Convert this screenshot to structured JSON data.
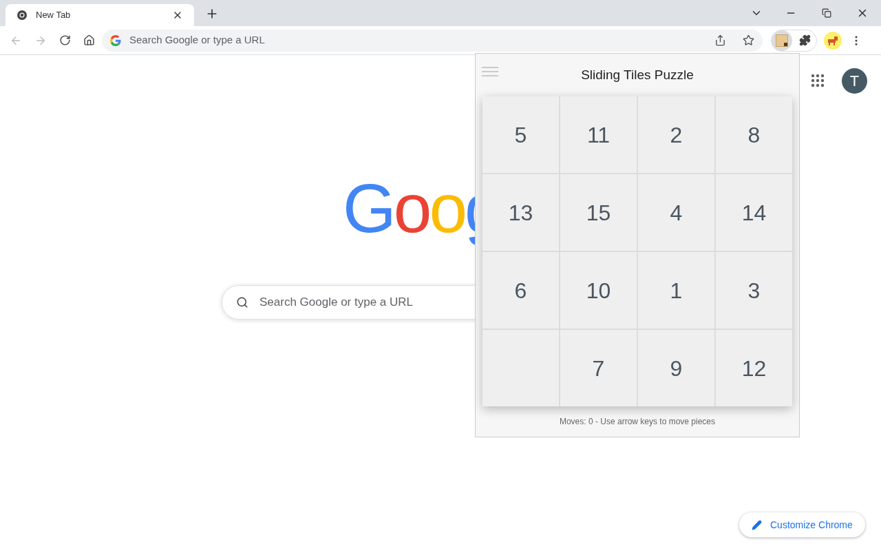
{
  "tab": {
    "title": "New Tab",
    "selected": true
  },
  "omnibox": {
    "placeholder": "Search Google or type a URL"
  },
  "logo": {
    "text": "Goog"
  },
  "search": {
    "placeholder": "Search Google or type a URL"
  },
  "avatar": {
    "initial": "T"
  },
  "popup": {
    "title": "Sliding Tiles Puzzle",
    "status": "Moves: 0 - Use arrow keys to move pieces",
    "tiles": [
      {
        "kind": "tile",
        "label": "5"
      },
      {
        "kind": "tile",
        "label": "11"
      },
      {
        "kind": "tile",
        "label": "2"
      },
      {
        "kind": "tile",
        "label": "8"
      },
      {
        "kind": "tile",
        "label": "13"
      },
      {
        "kind": "tile",
        "label": "15"
      },
      {
        "kind": "tile",
        "label": "4"
      },
      {
        "kind": "tile",
        "label": "14"
      },
      {
        "kind": "tile",
        "label": "6"
      },
      {
        "kind": "tile",
        "label": "10"
      },
      {
        "kind": "tile",
        "label": "1"
      },
      {
        "kind": "tile",
        "label": "3"
      },
      {
        "kind": "blank"
      },
      {
        "kind": "tile",
        "label": "7"
      },
      {
        "kind": "tile",
        "label": "9"
      },
      {
        "kind": "tile",
        "label": "12"
      }
    ]
  },
  "customize_button": {
    "label": "Customize Chrome"
  }
}
